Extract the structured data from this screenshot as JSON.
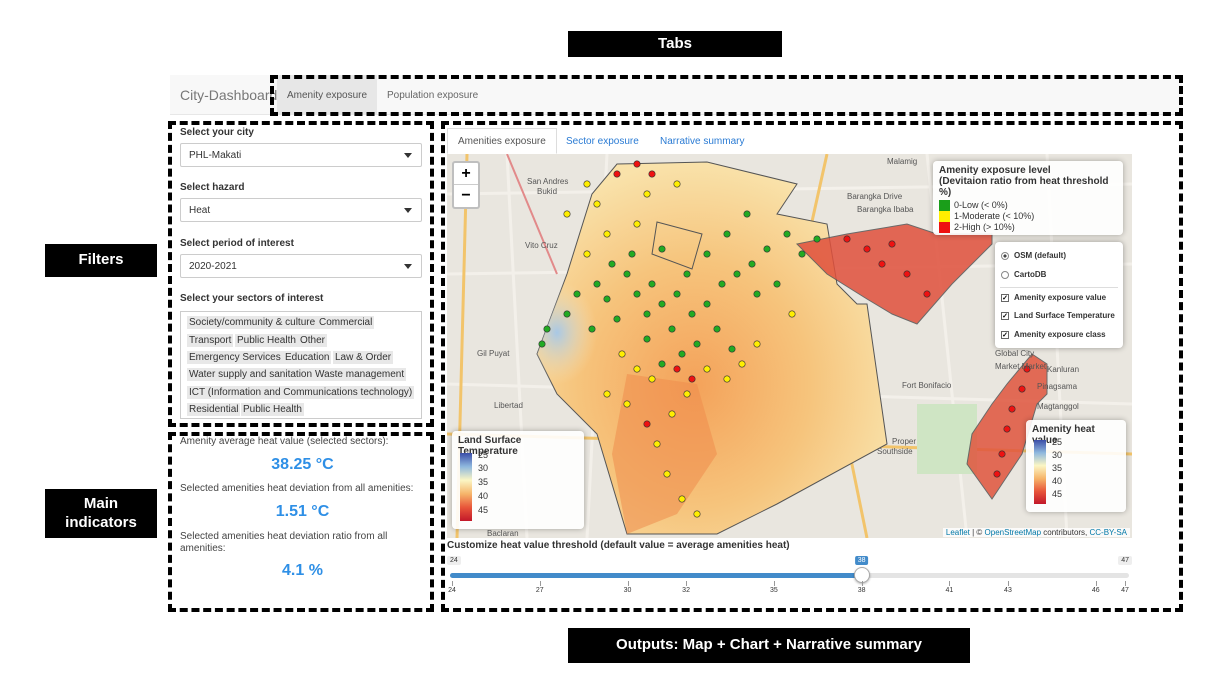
{
  "callouts": {
    "tabs": "Tabs",
    "filters": "Filters",
    "main_indicators_line1": "Main",
    "main_indicators_line2": "indicators",
    "outputs": "Outputs: Map + Chart + Narrative summary"
  },
  "navbar": {
    "brand": "City-Dashboard",
    "tabs": [
      {
        "label": "Amenity exposure",
        "active": true
      },
      {
        "label": "Population exposure",
        "active": false
      }
    ]
  },
  "filters": {
    "city": {
      "label": "Select your city",
      "value": "PHL-Makati"
    },
    "hazard": {
      "label": "Select hazard",
      "value": "Heat"
    },
    "period": {
      "label": "Select period of interest",
      "value": "2020-2021"
    },
    "sectors": {
      "label": "Select your sectors of interest",
      "items": [
        "Society/community & culture",
        "Commercial",
        "Transport",
        "Public Health",
        "Other",
        "Emergency Services",
        "Education",
        "Law & Order",
        "Water supply and sanitation",
        "Waste management",
        "ICT (Information and Communications technology)",
        "Residential",
        "Public Health"
      ]
    }
  },
  "indicators": {
    "avg_label": "Amenity average heat value (selected sectors):",
    "avg_value": "38.25 °C",
    "dev_label": "Selected amenities heat deviation from all amenities:",
    "dev_value": "1.51 °C",
    "ratio_label_line1": "Selected amenities heat deviation ratio from all",
    "ratio_label_line2": "amenities:",
    "ratio_value": "4.1 %"
  },
  "output_tabs": [
    {
      "label": "Amenities exposure",
      "active": true
    },
    {
      "label": "Sector exposure",
      "active": false
    },
    {
      "label": "Narrative summary",
      "active": false
    }
  ],
  "map": {
    "zoom_in": "+",
    "zoom_out": "−",
    "exposure_legend": {
      "title_line1": "Amenity exposure level",
      "title_line2": "(Devitaion ratio from heat threshold %)",
      "items": [
        {
          "label": "0-Low (< 0%)",
          "color": "#1a9e1a"
        },
        {
          "label": "1-Moderate (< 10%)",
          "color": "#ffee00"
        },
        {
          "label": "2-High (> 10%)",
          "color": "#ee1111"
        }
      ]
    },
    "layers": {
      "base": [
        {
          "label": "OSM (default)",
          "selected": true
        },
        {
          "label": "CartoDB",
          "selected": false
        }
      ],
      "overlays": [
        {
          "label": "Amenity exposure value",
          "checked": true
        },
        {
          "label": "Land Surface Temperature",
          "checked": true
        },
        {
          "label": "Amenity exposure class",
          "checked": true
        }
      ]
    },
    "lst_legend": {
      "title": "Land Surface Temperature",
      "ticks": [
        "25",
        "30",
        "35",
        "40",
        "45"
      ]
    },
    "heat_legend": {
      "title": "Amenity heat value",
      "ticks": [
        "25",
        "30",
        "35",
        "40",
        "45"
      ]
    },
    "attribution": {
      "leaflet": "Leaflet",
      "sep": " | © ",
      "osm": "OpenStreetMap",
      "contrib": " contributors, ",
      "license": "CC-BY-SA"
    },
    "place_labels": [
      "San Andres Bukid",
      "Malamig",
      "Barangka Drive",
      "Barangka Ibaba",
      "Vito Cruz",
      "Gil Puyat",
      "Libertad",
      "Fort Bonifacio",
      "Pinagsama",
      "Kanluran",
      "Magtanggol",
      "Proper Southside",
      "Baclaran",
      "Market Market",
      "Global City"
    ]
  },
  "slider": {
    "label": "Customize heat value threshold (default value = average amenities heat)",
    "min": 24,
    "max": 47,
    "value": 38,
    "min_label": "24",
    "max_label": "47",
    "value_label": "38",
    "ticks": [
      "24",
      "27",
      "30",
      "32",
      "35",
      "38",
      "41",
      "43",
      "46",
      "47"
    ],
    "tick_values": [
      24,
      27,
      30,
      32,
      35,
      38,
      41,
      43,
      46,
      47
    ]
  },
  "colors": {
    "accent": "#2e8fe6",
    "low": "#1a9e1a",
    "moderate": "#ffee00",
    "high": "#ee1111"
  }
}
